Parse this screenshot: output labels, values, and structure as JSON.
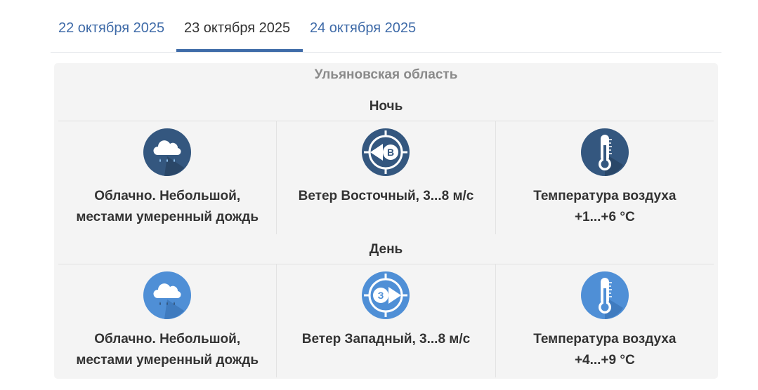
{
  "tabs": [
    {
      "label": "22 октября 2025",
      "active": false
    },
    {
      "label": "23 октября 2025",
      "active": true
    },
    {
      "label": "24 октября 2025",
      "active": false
    }
  ],
  "region": "Ульяновская область",
  "colors": {
    "link": "#3f6ba8",
    "night_icon": "#34577f",
    "day_icon": "#4f8fd6",
    "panel_bg": "#f4f4f4"
  },
  "periods": [
    {
      "name": "Ночь",
      "weather": {
        "icon": "cloud-rain-icon",
        "line1": "Облачно. Небольшой,",
        "line2": "местами умеренный дождь"
      },
      "wind": {
        "icon": "compass-east-icon",
        "letter": "В",
        "text": "Ветер Восточный, 3...8 м/с"
      },
      "temperature": {
        "icon": "thermometer-icon",
        "line1": "Температура воздуха",
        "line2": "+1...+6 °C"
      }
    },
    {
      "name": "День",
      "weather": {
        "icon": "cloud-rain-icon",
        "line1": "Облачно. Небольшой,",
        "line2": "местами умеренный дождь"
      },
      "wind": {
        "icon": "compass-west-icon",
        "letter": "З",
        "text": "Ветер Западный, 3...8 м/с"
      },
      "temperature": {
        "icon": "thermometer-icon",
        "line1": "Температура воздуха",
        "line2": "+4...+9 °C"
      }
    }
  ]
}
